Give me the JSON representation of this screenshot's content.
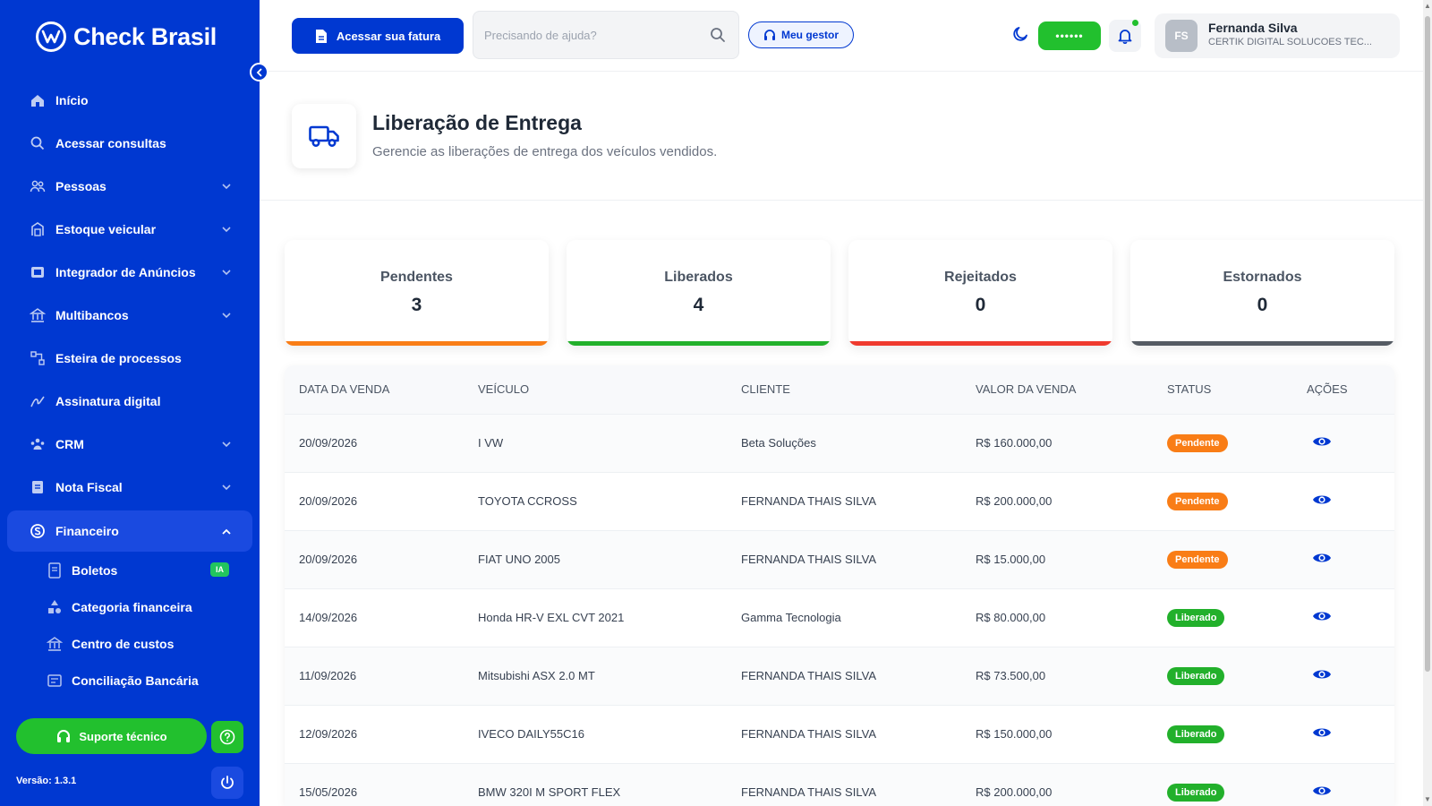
{
  "brand": {
    "name": "Check Brasil"
  },
  "sidebar": {
    "items": [
      {
        "label": "Início",
        "icon": "home-icon",
        "has_chevron": false
      },
      {
        "label": "Acessar consultas",
        "icon": "search-icon",
        "has_chevron": false
      },
      {
        "label": "Pessoas",
        "icon": "users-icon",
        "has_chevron": true
      },
      {
        "label": "Estoque veicular",
        "icon": "warehouse-icon",
        "has_chevron": true
      },
      {
        "label": "Integrador de Anúncios",
        "icon": "ads-icon",
        "has_chevron": true
      },
      {
        "label": "Multibancos",
        "icon": "bank-icon",
        "has_chevron": true
      },
      {
        "label": "Esteira de processos",
        "icon": "workflow-icon",
        "has_chevron": false
      },
      {
        "label": "Assinatura digital",
        "icon": "signature-icon",
        "has_chevron": false
      },
      {
        "label": "CRM",
        "icon": "crm-icon",
        "has_chevron": true
      },
      {
        "label": "Nota Fiscal",
        "icon": "invoice-icon",
        "has_chevron": true
      },
      {
        "label": "Financeiro",
        "icon": "finance-icon",
        "has_chevron": true,
        "active": true
      }
    ],
    "subitems": [
      {
        "label": "Boletos",
        "badge": "IA"
      },
      {
        "label": "Categoria financeira"
      },
      {
        "label": "Centro de custos"
      },
      {
        "label": "Conciliação Bancária"
      }
    ],
    "support_label": "Suporte técnico",
    "version": "Versão: 1.3.1"
  },
  "topbar": {
    "invoice_label": "Acessar sua fatura",
    "search_placeholder": "Precisando de ajuda?",
    "gestor_label": "Meu gestor",
    "password_mask": "••••••",
    "user": {
      "initials": "FS",
      "name": "Fernanda Silva",
      "company": "CERTIK DIGITAL SOLUCOES TEC..."
    }
  },
  "page": {
    "title": "Liberação de Entrega",
    "subtitle": "Gerencie as liberações de entrega dos veículos vendidos."
  },
  "stats": [
    {
      "label": "Pendentes",
      "value": "3",
      "color": "#f97d16"
    },
    {
      "label": "Liberados",
      "value": "4",
      "color": "#22b02b"
    },
    {
      "label": "Rejeitados",
      "value": "0",
      "color": "#ef3a2e"
    },
    {
      "label": "Estornados",
      "value": "0",
      "color": "#555b63"
    }
  ],
  "table": {
    "headers": [
      "DATA DA VENDA",
      "VEÍCULO",
      "CLIENTE",
      "VALOR DA VENDA",
      "STATUS",
      "AÇÕES"
    ],
    "rows": [
      {
        "date": "20/09/2026",
        "vehicle": "I VW",
        "client": "Beta Soluções",
        "value": "R$ 160.000,00",
        "status": "Pendente"
      },
      {
        "date": "20/09/2026",
        "vehicle": "TOYOTA CCROSS",
        "client": "FERNANDA THAIS SILVA",
        "value": "R$ 200.000,00",
        "status": "Pendente"
      },
      {
        "date": "20/09/2026",
        "vehicle": "FIAT UNO 2005",
        "client": "FERNANDA THAIS SILVA",
        "value": "R$ 15.000,00",
        "status": "Pendente"
      },
      {
        "date": "14/09/2026",
        "vehicle": "Honda HR-V EXL CVT 2021",
        "client": "Gamma Tecnologia",
        "value": "R$ 80.000,00",
        "status": "Liberado"
      },
      {
        "date": "11/09/2026",
        "vehicle": "Mitsubishi ASX 2.0 MT",
        "client": "FERNANDA THAIS SILVA",
        "value": "R$ 73.500,00",
        "status": "Liberado"
      },
      {
        "date": "12/09/2026",
        "vehicle": "IVECO DAILY55C16",
        "client": "FERNANDA THAIS SILVA",
        "value": "R$ 150.000,00",
        "status": "Liberado"
      },
      {
        "date": "15/05/2026",
        "vehicle": "BMW 320I M SPORT FLEX",
        "client": "FERNANDA THAIS SILVA",
        "value": "R$ 200.000,00",
        "status": "Liberado"
      }
    ]
  },
  "colors": {
    "primary": "#0038d1",
    "success": "#22c02e",
    "warning": "#f97d16",
    "danger": "#ef3a2e"
  }
}
